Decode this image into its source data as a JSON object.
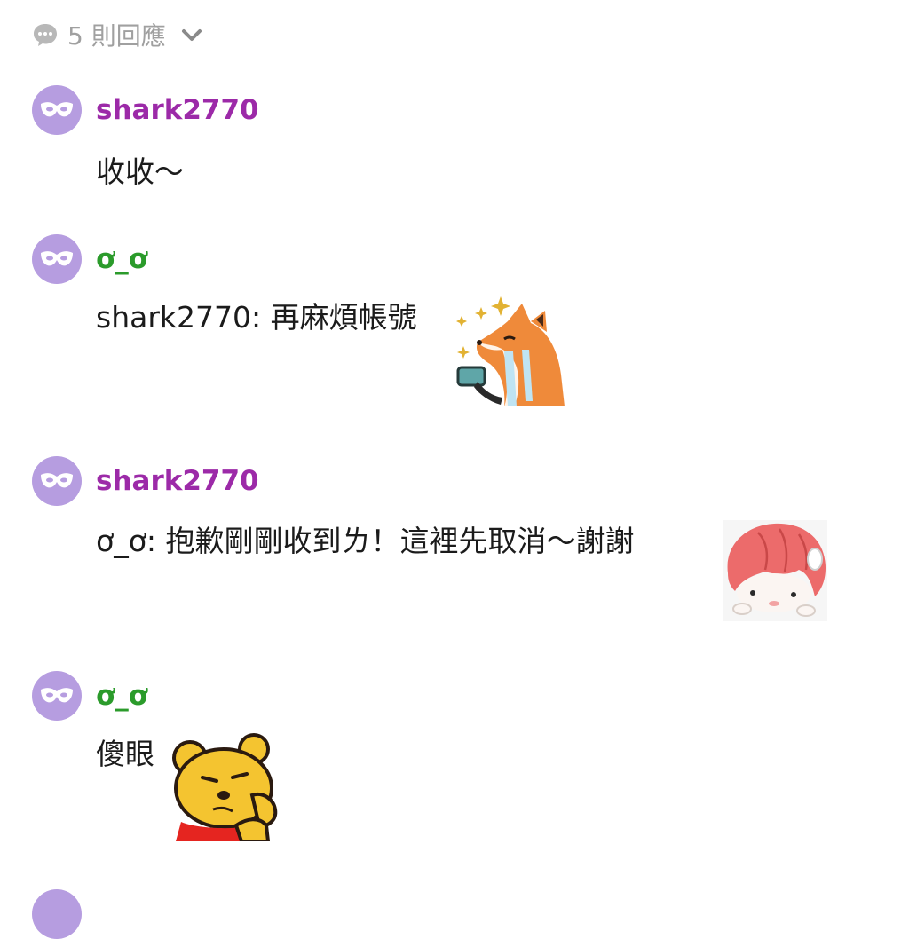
{
  "header": {
    "reply_count_label": "5 則回應",
    "bubble_icon": "comment-bubble-icon",
    "chevron_icon": "chevron-down-icon"
  },
  "replies": [
    {
      "author": "shark2770",
      "author_color": "#9c2aa8",
      "text": "收收～",
      "sticker": null
    },
    {
      "author": "ơ_ơ",
      "author_color": "#2b9b2b",
      "text": "shark2770: 再麻煩帳號",
      "sticker": "crying-fox-sticker"
    },
    {
      "author": "shark2770",
      "author_color": "#9c2aa8",
      "text": "ơ_ơ: 抱歉剛剛收到ㄌ！這裡先取消～謝謝",
      "sticker": "red-hair-girl-sticker"
    },
    {
      "author": "ơ_ơ",
      "author_color": "#2b9b2b",
      "text": "傻眼",
      "sticker": "yellow-bear-sticker"
    }
  ],
  "theme": {
    "avatar_color": "#b69de0",
    "header_color": "#a0a0a0"
  }
}
